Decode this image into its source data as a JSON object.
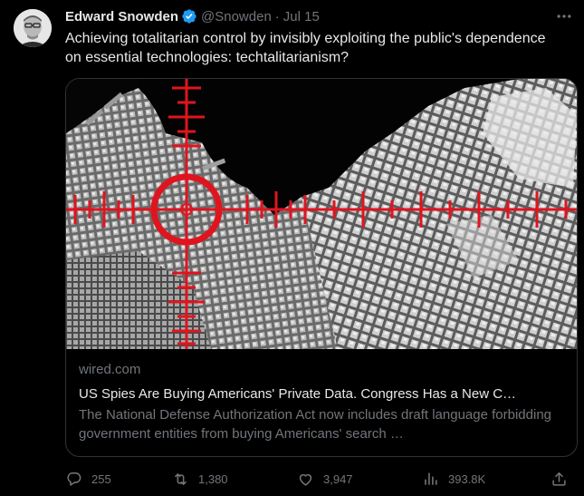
{
  "tweet": {
    "author": {
      "display_name": "Edward Snowden",
      "handle": "@Snowden",
      "verified": true,
      "separator": "·",
      "date": "Jul 15"
    },
    "text": "Achieving totalitarian control by invisibly exploiting the public's dependence on essential technologies: techtalitarianism?",
    "card": {
      "domain": "wired.com",
      "title": "US Spies Are Buying Americans' Private Data. Congress Has a New C…",
      "description": "The National Defense Authorization Act now includes draft language forbidding government entities from buying Americans' search …"
    },
    "actions": {
      "replies": "255",
      "retweets": "1,380",
      "likes": "3,947",
      "views": "393.8K"
    }
  },
  "icons": {
    "verified": "verified-badge-icon",
    "more": "more-horizontal-icon",
    "reply": "reply-bubble-icon",
    "retweet": "retweet-arrows-icon",
    "like": "heart-icon",
    "views": "views-bar-chart-icon",
    "share": "share-upload-icon"
  },
  "colors": {
    "background": "#000000",
    "text_primary": "#e7e9ea",
    "text_secondary": "#71767b",
    "border": "#2f3336",
    "verified_blue": "#1d9bf0",
    "crosshair_red": "#e0141e"
  }
}
